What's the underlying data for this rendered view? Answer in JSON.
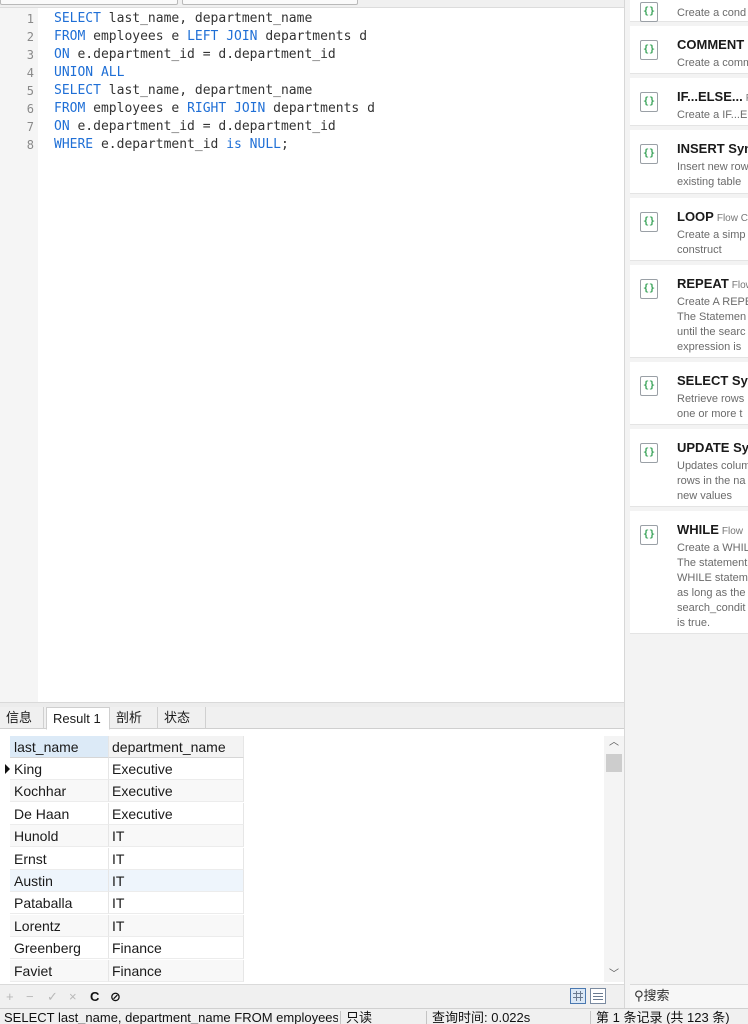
{
  "editor": {
    "lines": [
      {
        "n": "1",
        "parts": [
          {
            "t": "SELECT",
            "k": true
          },
          {
            "t": " last_name, department_name",
            "k": false
          }
        ]
      },
      {
        "n": "2",
        "parts": [
          {
            "t": "FROM",
            "k": true
          },
          {
            "t": " employees e ",
            "k": false
          },
          {
            "t": "LEFT JOIN",
            "k": true
          },
          {
            "t": " departments d",
            "k": false
          }
        ]
      },
      {
        "n": "3",
        "parts": [
          {
            "t": "ON",
            "k": true
          },
          {
            "t": " e.department_id = d.department_id",
            "k": false
          }
        ]
      },
      {
        "n": "4",
        "parts": [
          {
            "t": "UNION ALL",
            "k": true
          }
        ]
      },
      {
        "n": "5",
        "parts": [
          {
            "t": "SELECT",
            "k": true
          },
          {
            "t": " last_name, department_name",
            "k": false
          }
        ]
      },
      {
        "n": "6",
        "parts": [
          {
            "t": "FROM",
            "k": true
          },
          {
            "t": " employees e ",
            "k": false
          },
          {
            "t": "RIGHT JOIN",
            "k": true
          },
          {
            "t": " departments d",
            "k": false
          }
        ]
      },
      {
        "n": "7",
        "parts": [
          {
            "t": "ON",
            "k": true
          },
          {
            "t": " e.department_id = d.department_id",
            "k": false
          }
        ]
      },
      {
        "n": "8",
        "parts": [
          {
            "t": "WHERE",
            "k": true
          },
          {
            "t": " e.department_id ",
            "k": false
          },
          {
            "t": "is NULL",
            "k": true
          },
          {
            "t": ";",
            "k": false
          }
        ]
      }
    ]
  },
  "tabs": [
    "信息",
    "Result 1",
    "剖析",
    "状态"
  ],
  "grid": {
    "headers": [
      "last_name",
      "department_name"
    ],
    "rows": [
      [
        "King",
        "Executive"
      ],
      [
        "Kochhar",
        "Executive"
      ],
      [
        "De Haan",
        "Executive"
      ],
      [
        "Hunold",
        "IT"
      ],
      [
        "Ernst",
        "IT"
      ],
      [
        "Austin",
        "IT"
      ],
      [
        "Pataballa",
        "IT"
      ],
      [
        "Lorentz",
        "IT"
      ],
      [
        "Greenberg",
        "Finance"
      ],
      [
        "Faviet",
        "Finance"
      ]
    ]
  },
  "gridbar": {
    "add": "+",
    "remove": "−",
    "apply": "✓",
    "discard": "×",
    "refresh": "C",
    "stop": "⊘"
  },
  "status": {
    "sql": "SELECT last_name, department_name FROM employees e LEFT JOIN departments d",
    "readonly": "只读",
    "query_time": "查询时间: 0.022s",
    "records": "第 1 条记录 (共 123 条)"
  },
  "snippets": [
    {
      "title": "",
      "tag": "",
      "desc": "Create a cond"
    },
    {
      "title": "COMMENT",
      "tag": "",
      "desc": "Create a comm"
    },
    {
      "title": "IF...ELSE...",
      "tag": "F",
      "desc": "Create a IF...E"
    },
    {
      "title": "INSERT Syn",
      "tag": "",
      "desc": "Insert new row\nexisting table"
    },
    {
      "title": "LOOP",
      "tag": "Flow C",
      "desc": "Create a simp\nconstruct"
    },
    {
      "title": "REPEAT",
      "tag": "Flow",
      "desc": "Create A REPE\nThe Statemen\nuntil the searc\nexpression is"
    },
    {
      "title": "SELECT Syn",
      "tag": "",
      "desc": "Retrieve rows\none or more t"
    },
    {
      "title": "UPDATE Sy",
      "tag": "",
      "desc": "Updates colum\nrows in the na\nnew values"
    },
    {
      "title": "WHILE",
      "tag": "Flow",
      "desc": "Create a WHIL\nThe statement\nWHILE statem\nas long as the\nsearch_condit\nis true."
    }
  ],
  "search": {
    "label": "搜索",
    "icon": "search-icon"
  },
  "icons": {
    "snippet": "code-brackets-icon"
  }
}
